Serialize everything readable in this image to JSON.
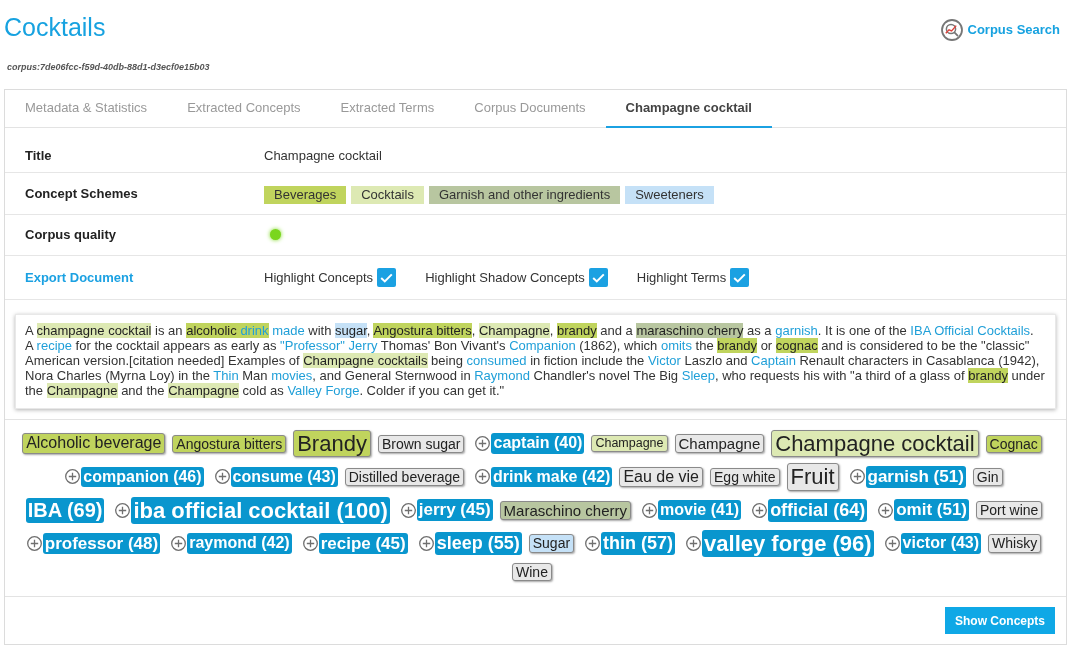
{
  "header": {
    "title": "Cocktails",
    "search_link": "Corpus Search",
    "corpus_id": "corpus:7de06fcc-f59d-40db-88d1-d3ecf0e15b03"
  },
  "tabs": [
    {
      "label": "Metadata & Statistics",
      "selected": false
    },
    {
      "label": "Extracted Concepts",
      "selected": false
    },
    {
      "label": "Extracted Terms",
      "selected": false
    },
    {
      "label": "Corpus Documents",
      "selected": false
    },
    {
      "label": "Champagne cocktail",
      "selected": true
    }
  ],
  "details": {
    "title": {
      "label": "Title",
      "value": "Champagne cocktail"
    },
    "concept_schemes": {
      "label": "Concept Schemes",
      "schemes": [
        {
          "name": "Beverages",
          "color": "#c0d45d"
        },
        {
          "name": "Cocktails",
          "color": "#dde9b3"
        },
        {
          "name": "Garnish and other ingredients",
          "color": "#b8c6a0"
        },
        {
          "name": "Sweeteners",
          "color": "#c5e1f7"
        }
      ]
    },
    "corpus_quality": {
      "label": "Corpus quality",
      "color": "#7ad61d"
    },
    "export": {
      "link": "Export Document",
      "options": [
        {
          "label": "Highlight Concepts",
          "checked": true
        },
        {
          "label": "Highlight Shadow Concepts",
          "checked": true
        },
        {
          "label": "Highlight Terms",
          "checked": true
        }
      ]
    }
  },
  "document": {
    "paragraphs": [
      {
        "segments": [
          {
            "kind": "plain",
            "text": "A "
          },
          {
            "kind": "concept",
            "text": "champagne cocktail",
            "color": "#dde9b3"
          },
          {
            "kind": "plain",
            "text": " is an "
          },
          {
            "kind": "concept",
            "text": "alcoholic ",
            "color": "#c0d45d"
          },
          {
            "kind": "term",
            "text": "drink",
            "color": "#c0d45d"
          },
          {
            "kind": "term",
            "text": " made"
          },
          {
            "kind": "plain",
            "text": " with "
          },
          {
            "kind": "concept",
            "text": "sugar",
            "color": "#c5e1f7"
          },
          {
            "kind": "plain",
            "text": ", "
          },
          {
            "kind": "concept",
            "text": "Angostura bitters",
            "color": "#c0d45d"
          },
          {
            "kind": "plain",
            "text": ", "
          },
          {
            "kind": "concept",
            "text": "Champagne",
            "color": "#dde9b3"
          },
          {
            "kind": "plain",
            "text": ", "
          },
          {
            "kind": "concept",
            "text": "brandy",
            "color": "#c0d45d"
          },
          {
            "kind": "plain",
            "text": " and a "
          },
          {
            "kind": "concept",
            "text": "maraschino cherry",
            "color": "#b8c6a0"
          },
          {
            "kind": "plain",
            "text": " as a "
          },
          {
            "kind": "term",
            "text": "garnish"
          },
          {
            "kind": "plain",
            "text": ". It is one of the "
          },
          {
            "kind": "term",
            "text": "IBA Official Cocktails"
          },
          {
            "kind": "plain",
            "text": "."
          }
        ]
      },
      {
        "segments": [
          {
            "kind": "plain",
            "text": "A "
          },
          {
            "kind": "term",
            "text": "recipe"
          },
          {
            "kind": "plain",
            "text": " for the cocktail appears as early as "
          },
          {
            "kind": "term",
            "text": "\"Professor\""
          },
          {
            "kind": "term",
            "text": " Jerry"
          },
          {
            "kind": "plain",
            "text": " Thomas' Bon Vivant's "
          },
          {
            "kind": "term",
            "text": "Companion"
          },
          {
            "kind": "plain",
            "text": " (1862), which "
          },
          {
            "kind": "term",
            "text": "omits"
          },
          {
            "kind": "plain",
            "text": " the "
          },
          {
            "kind": "concept",
            "text": "brandy",
            "color": "#c0d45d"
          },
          {
            "kind": "plain",
            "text": " or "
          },
          {
            "kind": "concept",
            "text": "cognac",
            "color": "#c0d45d"
          },
          {
            "kind": "plain",
            "text": " and is considered to be the \"classic\" American version.[citation needed] Examples of "
          },
          {
            "kind": "concept",
            "text": "Champagne cocktails",
            "color": "#dde9b3"
          },
          {
            "kind": "plain",
            "text": " being "
          },
          {
            "kind": "term",
            "text": "consumed"
          },
          {
            "kind": "plain",
            "text": " in fiction include the "
          },
          {
            "kind": "term",
            "text": "Victor"
          },
          {
            "kind": "plain",
            "text": " Laszlo and "
          },
          {
            "kind": "term",
            "text": "Captain"
          },
          {
            "kind": "plain",
            "text": " Renault characters in Casablanca (1942), Nora Charles (Myrna Loy) in the "
          },
          {
            "kind": "term",
            "text": "Thin"
          },
          {
            "kind": "plain",
            "text": " Man "
          },
          {
            "kind": "term",
            "text": "movies"
          },
          {
            "kind": "plain",
            "text": ", and General Sternwood in "
          },
          {
            "kind": "term",
            "text": "Raymond"
          },
          {
            "kind": "plain",
            "text": " Chandler's novel The Big "
          },
          {
            "kind": "term",
            "text": "Sleep"
          },
          {
            "kind": "plain",
            "text": ", who requests his with \"a third of a glass of "
          },
          {
            "kind": "concept",
            "text": "brandy",
            "color": "#c0d45d"
          },
          {
            "kind": "plain",
            "text": " under the "
          },
          {
            "kind": "concept",
            "text": "Champagne",
            "color": "#dde9b3"
          },
          {
            "kind": "plain",
            "text": " and the "
          },
          {
            "kind": "concept",
            "text": "Champagne",
            "color": "#dde9b3"
          },
          {
            "kind": "plain",
            "text": " cold as "
          },
          {
            "kind": "term",
            "text": "Valley Forge"
          },
          {
            "kind": "plain",
            "text": ". Colder if you can get it.\""
          }
        ]
      }
    ]
  },
  "tag_cloud": {
    "tags": [
      {
        "label": "Alcoholic beverage",
        "kind": "concept_large",
        "color": "#c0d45d"
      },
      {
        "label": "Angostura bitters",
        "kind": "concept_small",
        "color": "#c0d45d"
      },
      {
        "label": "Brandy",
        "kind": "concept_huge",
        "color": "#c0d45d"
      },
      {
        "label": "Brown sugar",
        "kind": "concept_small",
        "color": "#e8e8e8"
      },
      {
        "label": "captain (40)",
        "kind": "term_small",
        "addable": true
      },
      {
        "label": "Champagne",
        "kind": "concept_tiny",
        "color": "#dde9b3"
      },
      {
        "label": "Champagne",
        "kind": "concept_medium",
        "color": "#e8e8e8"
      },
      {
        "label": "Champagne cocktail",
        "kind": "concept_huge",
        "color": "#dde9b3"
      },
      {
        "label": "Cognac",
        "kind": "concept_small",
        "color": "#c0d45d"
      },
      {
        "label": "companion (46)",
        "kind": "term_small",
        "addable": true
      },
      {
        "label": "consume (43)",
        "kind": "term_small",
        "addable": true
      },
      {
        "label": "Distilled beverage",
        "kind": "concept_small",
        "color": "#e8e8e8"
      },
      {
        "label": "drink make (42)",
        "kind": "term_small",
        "addable": true
      },
      {
        "label": "Eau de vie",
        "kind": "concept_large",
        "color": "#e8e8e8"
      },
      {
        "label": "Egg white",
        "kind": "concept_small",
        "color": "#e8e8e8"
      },
      {
        "label": "Fruit",
        "kind": "concept_huge",
        "color": "#e8e8e8"
      },
      {
        "label": "garnish (51)",
        "kind": "term_medium",
        "addable": true
      },
      {
        "label": "Gin",
        "kind": "concept_small",
        "color": "#e8e8e8"
      },
      {
        "label": "IBA (69)",
        "kind": "term_xlarge",
        "addable": false
      },
      {
        "label": "iba official cocktail (100)",
        "kind": "term_huge",
        "addable": true
      },
      {
        "label": "jerry (45)",
        "kind": "term_medium",
        "addable": true
      },
      {
        "label": "Maraschino cherry",
        "kind": "concept_medium",
        "color": "#b8c6a0"
      },
      {
        "label": "movie (41)",
        "kind": "term_small",
        "addable": true
      },
      {
        "label": "official (64)",
        "kind": "term_large",
        "addable": true
      },
      {
        "label": "omit (51)",
        "kind": "term_medium",
        "addable": true
      },
      {
        "label": "Port wine",
        "kind": "concept_small",
        "color": "#e8e8e8"
      },
      {
        "label": "professor (48)",
        "kind": "term_medium",
        "addable": true
      },
      {
        "label": "raymond (42)",
        "kind": "term_small",
        "addable": true
      },
      {
        "label": "recipe (45)",
        "kind": "term_medium",
        "addable": true
      },
      {
        "label": "sleep (55)",
        "kind": "term_large",
        "addable": true
      },
      {
        "label": "Sugar",
        "kind": "concept_small",
        "color": "#c5e1f7"
      },
      {
        "label": "thin (57)",
        "kind": "term_large",
        "addable": true
      },
      {
        "label": "valley forge (96)",
        "kind": "term_huge",
        "addable": true
      },
      {
        "label": "victor (43)",
        "kind": "term_small",
        "addable": true
      },
      {
        "label": "Whisky",
        "kind": "concept_small",
        "color": "#e8e8e8"
      },
      {
        "label": "Wine",
        "kind": "concept_small",
        "color": "#e8e8e8"
      }
    ]
  },
  "footer": {
    "button": "Show Concepts"
  }
}
